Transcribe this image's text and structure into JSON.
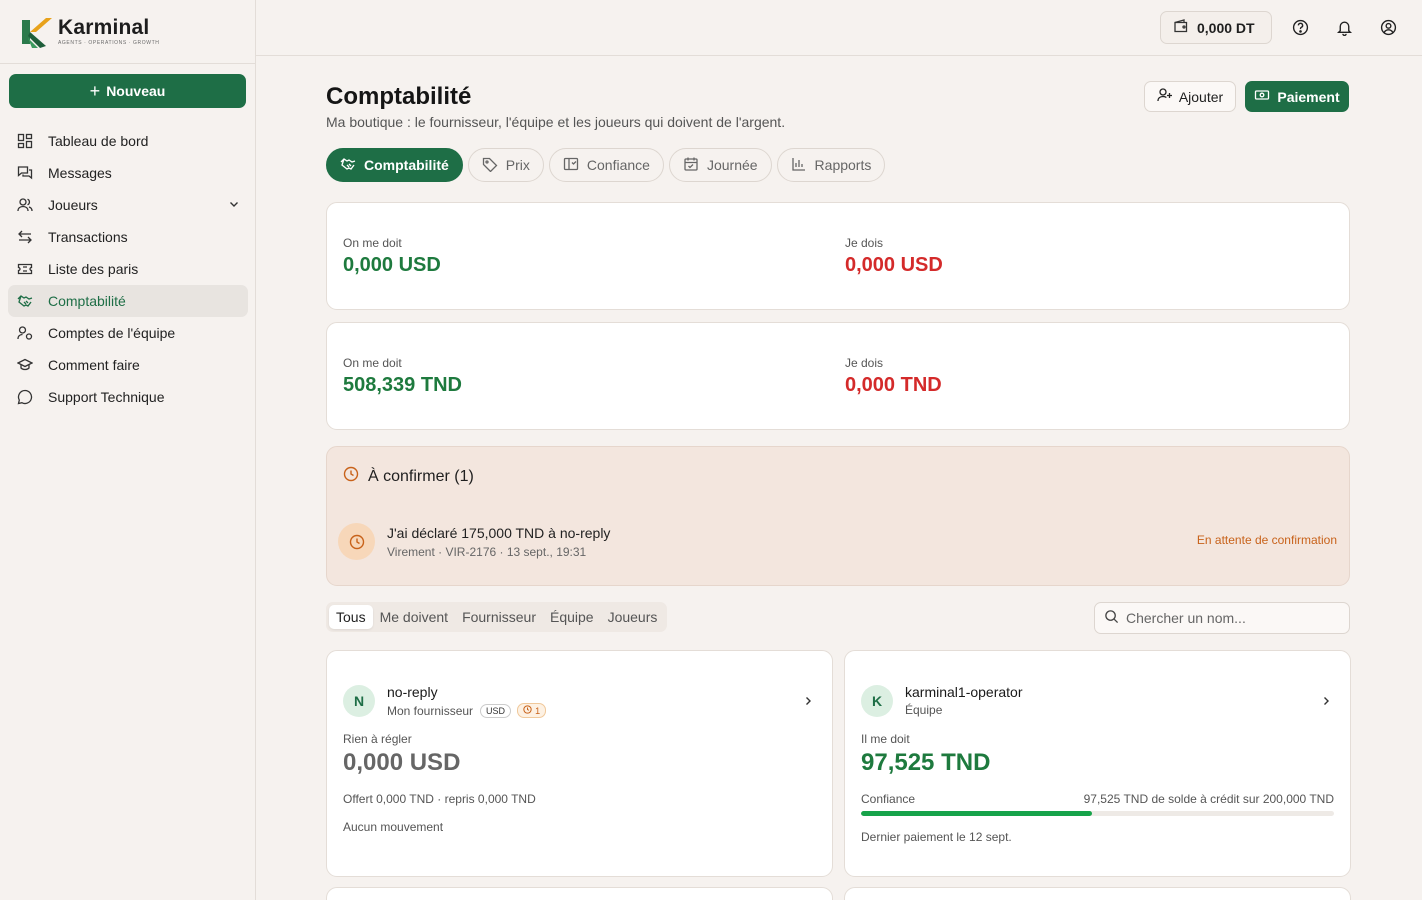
{
  "brand": {
    "name": "Karminal",
    "tagline": "AGENTS · OPERATIONS · GROWTH"
  },
  "sidebar": {
    "new_label": "Nouveau",
    "items": [
      {
        "label": "Tableau de bord",
        "icon": "dashboard-icon"
      },
      {
        "label": "Messages",
        "icon": "messages-icon"
      },
      {
        "label": "Joueurs",
        "icon": "users-icon"
      },
      {
        "label": "Transactions",
        "icon": "transfer-icon"
      },
      {
        "label": "Liste des paris",
        "icon": "ticket-icon"
      },
      {
        "label": "Comptabilité",
        "icon": "handshake-icon"
      },
      {
        "label": "Comptes de l'équipe",
        "icon": "team-icon"
      },
      {
        "label": "Comment faire",
        "icon": "graduation-cap-icon"
      },
      {
        "label": "Support Technique",
        "icon": "chat-bubble-icon"
      }
    ]
  },
  "topbar": {
    "balance": "0,000 DT"
  },
  "page": {
    "title": "Comptabilité",
    "subtitle": "Ma boutique : le fournisseur, l'équipe et les joueurs qui doivent de l'argent.",
    "add_label": "Ajouter",
    "pay_label": "Paiement"
  },
  "tabs": [
    "Comptabilité",
    "Prix",
    "Confiance",
    "Journée",
    "Rapports"
  ],
  "summary": [
    {
      "owed_label": "On me doit",
      "owed_value": "0,000 USD",
      "debt_label": "Je dois",
      "debt_value": "0,000 USD"
    },
    {
      "owed_label": "On me doit",
      "owed_value": "508,339 TND",
      "debt_label": "Je dois",
      "debt_value": "0,000 TND"
    }
  ],
  "pending": {
    "title": "À confirmer (1)",
    "item_title": "J'ai déclaré 175,000 TND à no-reply",
    "item_meta": "Virement · VIR-2176 · 13 sept., 19:31",
    "status": "En attente de confirmation"
  },
  "filters": [
    "Tous",
    "Me doivent",
    "Fournisseur",
    "Équipe",
    "Joueurs"
  ],
  "search": {
    "placeholder": "Chercher un nom..."
  },
  "cards": [
    {
      "initial": "N",
      "name": "no-reply",
      "role": "Mon fournisseur",
      "currency_badge": "USD",
      "pending_count": "1",
      "label": "Rien à régler",
      "amount": "0,000 USD",
      "line1": "Offert 0,000 TND · repris 0,000 TND",
      "line2": "Aucun mouvement"
    },
    {
      "initial": "K",
      "name": "karminal1-operator",
      "role": "Équipe",
      "label": "Il me doit",
      "amount": "97,525 TND",
      "trust_label": "Confiance",
      "trust_detail": "97,525 TND de solde à crédit sur 200,000 TND",
      "trust_fraction": 0.4876,
      "last_payment": "Dernier paiement le 12 sept."
    }
  ],
  "colors": {
    "brand_green": "#1e6e46",
    "positive": "#1e7a3e",
    "negative": "#d42a2a",
    "pending": "#c8621a",
    "progress": "#16a34a"
  }
}
